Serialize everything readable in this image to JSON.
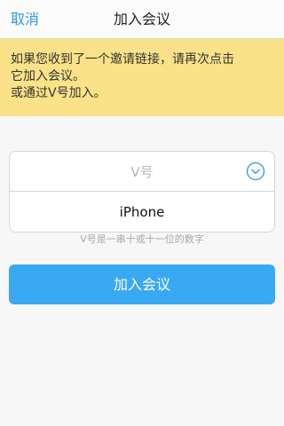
{
  "nav": {
    "cancel_label": "取消",
    "title": "加入会议"
  },
  "notice": {
    "line1": "如果您收到了一个邀请链接，请再次点击",
    "line2": "它加入会议。",
    "line3": "或通过V号加入。"
  },
  "form": {
    "vid_placeholder": "V号",
    "vid_value": "",
    "dropdown_icon": "chevron-down-circle-icon",
    "device_name": "iPhone",
    "hint": "V号是一串十或十一位的数字"
  },
  "actions": {
    "join_label": "加入会议"
  },
  "colors": {
    "accent": "#2f97e8",
    "button": "#39a9f4",
    "notice_bg": "#fbe289"
  }
}
